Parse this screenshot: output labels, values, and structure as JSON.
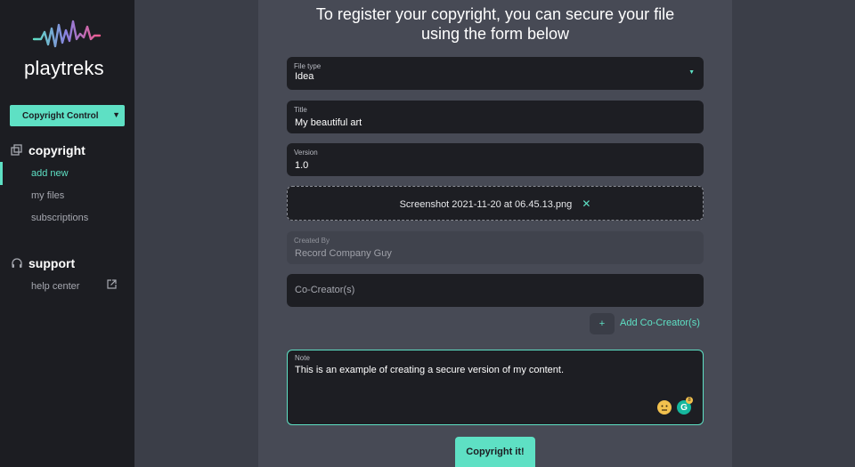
{
  "sidebar": {
    "logo_text": "playtreks",
    "select_value": "Copyright Control",
    "sections": [
      {
        "title": "copyright",
        "icon": "copy-stack-icon",
        "items": [
          {
            "label": "add new",
            "active": true
          },
          {
            "label": "my files",
            "active": false
          },
          {
            "label": "subscriptions",
            "active": false
          }
        ]
      },
      {
        "title": "support",
        "icon": "headset-icon",
        "items": [
          {
            "label": "help center",
            "active": false,
            "icon": "external-link-icon"
          }
        ]
      }
    ]
  },
  "form": {
    "heading_line1": "To register your copyright, you can secure your file",
    "heading_line2": "using the form below",
    "file_type": {
      "label": "File type",
      "value": "Idea"
    },
    "title": {
      "label": "Title",
      "value": "My beautiful art"
    },
    "version": {
      "label": "Version",
      "value": "1.0"
    },
    "file": {
      "name": "Screenshot 2021-11-20 at 06.45.13.png",
      "remove_icon": "✕"
    },
    "created_by": {
      "label": "Created By",
      "value": "Record  Company Guy"
    },
    "co_creator": {
      "placeholder": "Co-Creator(s)"
    },
    "add_co_creator": {
      "plus": "+",
      "label": "Add Co-Creator(s)"
    },
    "note": {
      "label": "Note",
      "value": "This is an example of creating a secure version of my content."
    },
    "grammarly_badge": "8",
    "submit_label": "Copyright it!"
  },
  "colors": {
    "accent": "#5ee0c4",
    "sidebar": "#1c1d22",
    "panel": "#474a55",
    "field": "#1d1e23"
  }
}
